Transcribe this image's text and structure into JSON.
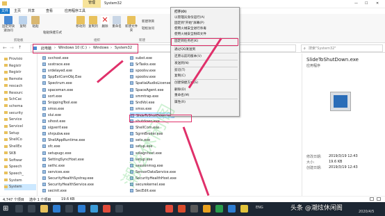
{
  "titlebar": {
    "manage_tab": "管理",
    "title": "System32",
    "min": "—",
    "max": "☐",
    "close": "✕"
  },
  "tabs": [
    "文件",
    "主页",
    "共享",
    "查看",
    "应用程序工具"
  ],
  "ribbon": {
    "pin": "固定到快速访问",
    "copy": "复制",
    "paste": "粘贴",
    "paste_shortcut": "粘贴快捷方式",
    "move_to": "移动到",
    "copy_to": "复制到",
    "delete": "删除",
    "rename": "重命名",
    "new_folder": "新建文件夹",
    "new_item": "新建项目",
    "easy_access": "轻松访问",
    "groups": [
      "剪贴板",
      "组织",
      "新建"
    ]
  },
  "address": {
    "crumbs": [
      "此电脑",
      "Windows 10 (C:)",
      "Windows",
      "System32"
    ],
    "sep": "›",
    "search_placeholder": "搜索\"System32\""
  },
  "nav": [
    "Provisio",
    "Registr",
    "Registr",
    "Remote",
    "rescach",
    "Resourc",
    "SchCac",
    "schema",
    "security",
    "Service",
    "ServiceI",
    "Setup",
    "ShellCo",
    "ShellEx",
    "SKB",
    "Softwar",
    "Speech",
    "Speech_",
    "System",
    "System"
  ],
  "files_col1": [
    "svchost.exe",
    "sxstrace.exe",
    "srdelayed.exe",
    "SppExtComObj.Exe",
    "Spectrum.exe",
    "spaceman.exe",
    "sort.exe",
    "SnippingTool.exe",
    "smss.exe",
    "slui.exe",
    "sihost.exe",
    "sigverif.exe",
    "shrpubw.exe",
    "ShellAppRuntime.exe",
    "sfc.exe",
    "setupugc.exe",
    "SettingSyncHost.exe",
    "sethc.exe",
    "services.exe",
    "SecurityHealthSystray.exe",
    "SecurityHealthService.exe",
    "secinit.exe"
  ],
  "files_col2": [
    "subst.exe",
    "SrTasks.exe",
    "spoolsv.exe",
    "spoolsv.exe",
    "SpatialAudioLicense.exe",
    "SpaceAgent.exe",
    "smmtrap.exe",
    "SndVol.exe",
    "smss.exe",
    "SlideToShutDown.exe",
    "shutdown.exe",
    "ShellCom.exe",
    "SgrmBroker.exe",
    "setx.exe",
    "setup.exe",
    "sdiagnhost.exe",
    "setup.exe",
    "sessionmsg.exe",
    "SensorDataService.exe",
    "SecurityHealthHost.exe",
    "securekernel.exe",
    "SecEdit.exe"
  ],
  "context_menu": [
    "打开(O)",
    "以管理员身份运行(A)",
    "固定到\"开始\"屏幕(P)",
    "使用火绒安全进行杀毒",
    "使用火绒安全粉碎文件",
    "固定到任务栏(K)",
    "通过QQ发送到",
    "还原以前的版本(V)",
    "发送到(N)",
    "剪切(T)",
    "复制(C)",
    "创建快捷方式(S)",
    "删除(D)",
    "重命名(M)",
    "属性(R)"
  ],
  "preview": {
    "name": "SlideToShutDown.exe",
    "type": "应用程序",
    "modified_label": "修改日期:",
    "modified": "2019/3/19 12:43",
    "size_label": "大小:",
    "size": "19.6 KB",
    "created_label": "创建日期:",
    "created": "2019/3/19 12:43"
  },
  "status": {
    "count": "4,747 个项目",
    "selected": "选中 1 个项目",
    "size": "19.6 KB"
  },
  "taskbar": {
    "tray": "ENG",
    "time": "",
    "date": "2020/4/5"
  },
  "watermark": "头条 @潮炫休闲阁",
  "colors": {
    "highlight": "#e0306a",
    "selection": "#cce8ff",
    "taskbar": "#1d2733"
  }
}
